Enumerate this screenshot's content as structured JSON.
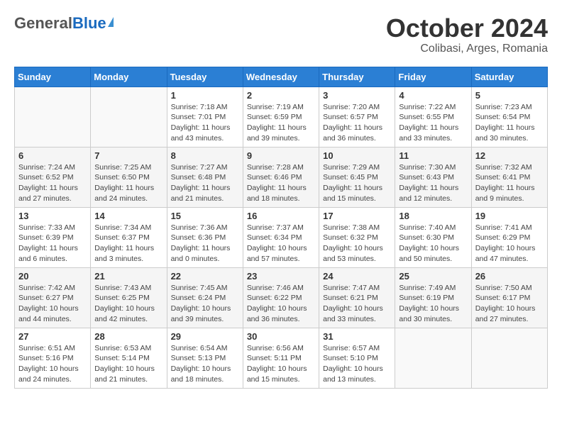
{
  "logo": {
    "general": "General",
    "blue": "Blue"
  },
  "header": {
    "month": "October 2024",
    "location": "Colibasi, Arges, Romania"
  },
  "weekdays": [
    "Sunday",
    "Monday",
    "Tuesday",
    "Wednesday",
    "Thursday",
    "Friday",
    "Saturday"
  ],
  "weeks": [
    [
      null,
      null,
      {
        "day": 1,
        "sunrise": "7:18 AM",
        "sunset": "7:01 PM",
        "daylight": "11 hours and 43 minutes."
      },
      {
        "day": 2,
        "sunrise": "7:19 AM",
        "sunset": "6:59 PM",
        "daylight": "11 hours and 39 minutes."
      },
      {
        "day": 3,
        "sunrise": "7:20 AM",
        "sunset": "6:57 PM",
        "daylight": "11 hours and 36 minutes."
      },
      {
        "day": 4,
        "sunrise": "7:22 AM",
        "sunset": "6:55 PM",
        "daylight": "11 hours and 33 minutes."
      },
      {
        "day": 5,
        "sunrise": "7:23 AM",
        "sunset": "6:54 PM",
        "daylight": "11 hours and 30 minutes."
      }
    ],
    [
      {
        "day": 6,
        "sunrise": "7:24 AM",
        "sunset": "6:52 PM",
        "daylight": "11 hours and 27 minutes."
      },
      {
        "day": 7,
        "sunrise": "7:25 AM",
        "sunset": "6:50 PM",
        "daylight": "11 hours and 24 minutes."
      },
      {
        "day": 8,
        "sunrise": "7:27 AM",
        "sunset": "6:48 PM",
        "daylight": "11 hours and 21 minutes."
      },
      {
        "day": 9,
        "sunrise": "7:28 AM",
        "sunset": "6:46 PM",
        "daylight": "11 hours and 18 minutes."
      },
      {
        "day": 10,
        "sunrise": "7:29 AM",
        "sunset": "6:45 PM",
        "daylight": "11 hours and 15 minutes."
      },
      {
        "day": 11,
        "sunrise": "7:30 AM",
        "sunset": "6:43 PM",
        "daylight": "11 hours and 12 minutes."
      },
      {
        "day": 12,
        "sunrise": "7:32 AM",
        "sunset": "6:41 PM",
        "daylight": "11 hours and 9 minutes."
      }
    ],
    [
      {
        "day": 13,
        "sunrise": "7:33 AM",
        "sunset": "6:39 PM",
        "daylight": "11 hours and 6 minutes."
      },
      {
        "day": 14,
        "sunrise": "7:34 AM",
        "sunset": "6:37 PM",
        "daylight": "11 hours and 3 minutes."
      },
      {
        "day": 15,
        "sunrise": "7:36 AM",
        "sunset": "6:36 PM",
        "daylight": "11 hours and 0 minutes."
      },
      {
        "day": 16,
        "sunrise": "7:37 AM",
        "sunset": "6:34 PM",
        "daylight": "10 hours and 57 minutes."
      },
      {
        "day": 17,
        "sunrise": "7:38 AM",
        "sunset": "6:32 PM",
        "daylight": "10 hours and 53 minutes."
      },
      {
        "day": 18,
        "sunrise": "7:40 AM",
        "sunset": "6:30 PM",
        "daylight": "10 hours and 50 minutes."
      },
      {
        "day": 19,
        "sunrise": "7:41 AM",
        "sunset": "6:29 PM",
        "daylight": "10 hours and 47 minutes."
      }
    ],
    [
      {
        "day": 20,
        "sunrise": "7:42 AM",
        "sunset": "6:27 PM",
        "daylight": "10 hours and 44 minutes."
      },
      {
        "day": 21,
        "sunrise": "7:43 AM",
        "sunset": "6:25 PM",
        "daylight": "10 hours and 42 minutes."
      },
      {
        "day": 22,
        "sunrise": "7:45 AM",
        "sunset": "6:24 PM",
        "daylight": "10 hours and 39 minutes."
      },
      {
        "day": 23,
        "sunrise": "7:46 AM",
        "sunset": "6:22 PM",
        "daylight": "10 hours and 36 minutes."
      },
      {
        "day": 24,
        "sunrise": "7:47 AM",
        "sunset": "6:21 PM",
        "daylight": "10 hours and 33 minutes."
      },
      {
        "day": 25,
        "sunrise": "7:49 AM",
        "sunset": "6:19 PM",
        "daylight": "10 hours and 30 minutes."
      },
      {
        "day": 26,
        "sunrise": "7:50 AM",
        "sunset": "6:17 PM",
        "daylight": "10 hours and 27 minutes."
      }
    ],
    [
      {
        "day": 27,
        "sunrise": "6:51 AM",
        "sunset": "5:16 PM",
        "daylight": "10 hours and 24 minutes."
      },
      {
        "day": 28,
        "sunrise": "6:53 AM",
        "sunset": "5:14 PM",
        "daylight": "10 hours and 21 minutes."
      },
      {
        "day": 29,
        "sunrise": "6:54 AM",
        "sunset": "5:13 PM",
        "daylight": "10 hours and 18 minutes."
      },
      {
        "day": 30,
        "sunrise": "6:56 AM",
        "sunset": "5:11 PM",
        "daylight": "10 hours and 15 minutes."
      },
      {
        "day": 31,
        "sunrise": "6:57 AM",
        "sunset": "5:10 PM",
        "daylight": "10 hours and 13 minutes."
      },
      null,
      null
    ]
  ],
  "labels": {
    "sunrise": "Sunrise:",
    "sunset": "Sunset:",
    "daylight": "Daylight:"
  }
}
